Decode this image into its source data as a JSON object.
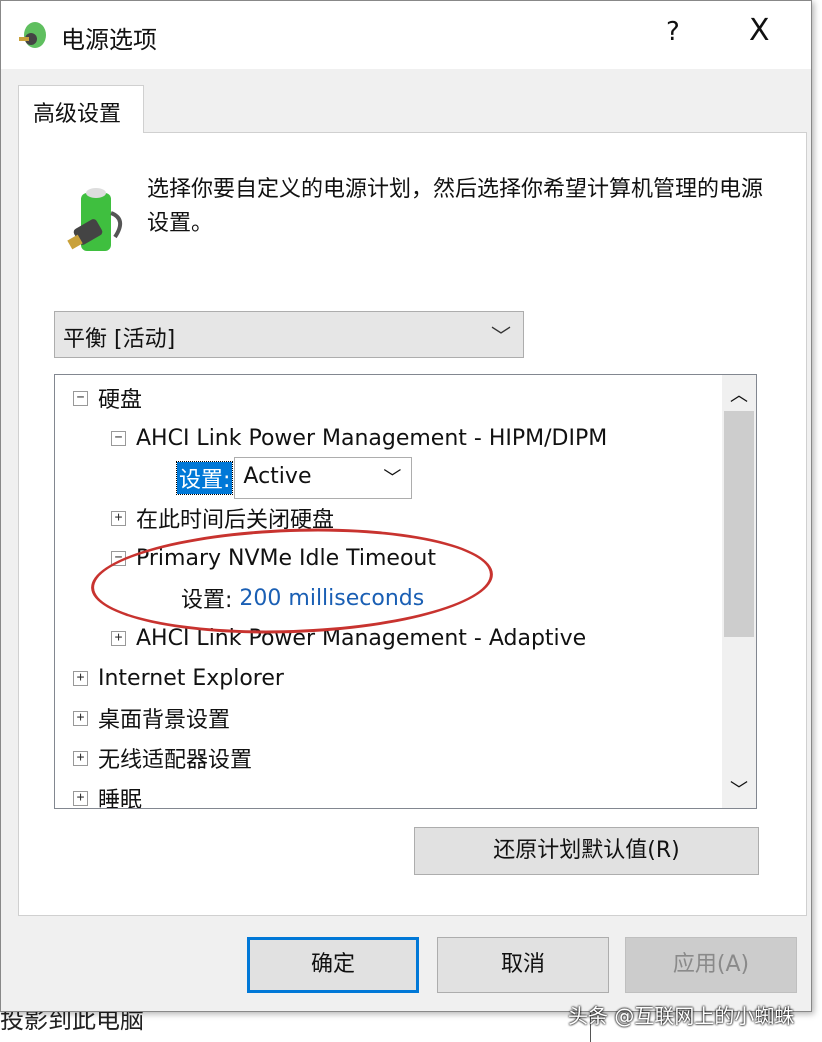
{
  "background": {
    "text": "投影到此电脑"
  },
  "dialog": {
    "title": "电源选项",
    "help": "?",
    "close": "X",
    "tab": "高级设置",
    "description": "选择你要自定义的电源计划，然后选择你希望计算机管理的电源设置。",
    "plan_select": {
      "value": "平衡 [活动]"
    },
    "tree": [
      {
        "expander": "−",
        "label": "硬盘"
      },
      {
        "expander": "−",
        "label": "AHCI Link Power Management - HIPM/DIPM"
      },
      {
        "setting_label": "设置:",
        "setting_value": "Active"
      },
      {
        "expander": "+",
        "label": "在此时间后关闭硬盘"
      },
      {
        "expander": "−",
        "label": "Primary NVMe Idle Timeout"
      },
      {
        "setting_label": "设置:",
        "setting_value": "200 milliseconds"
      },
      {
        "expander": "+",
        "label": "AHCI Link Power Management - Adaptive"
      },
      {
        "expander": "+",
        "label": "Internet Explorer"
      },
      {
        "expander": "+",
        "label": "桌面背景设置"
      },
      {
        "expander": "+",
        "label": "无线适配器设置"
      },
      {
        "expander": "+",
        "label": "睡眠"
      }
    ],
    "restore_button": "还原计划默认值(R)",
    "ok_button": "确定",
    "cancel_button": "取消",
    "apply_button": "应用(A)"
  },
  "watermark": "头条 @互联网上的小蜘蛛",
  "colors": {
    "accent": "#0078d7",
    "highlight_ellipse": "#c8332f"
  }
}
